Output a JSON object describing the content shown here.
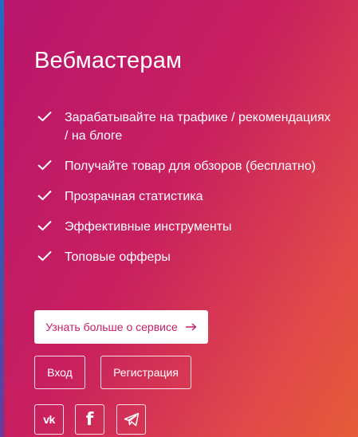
{
  "section": {
    "title": "Вебмастерам"
  },
  "features": [
    {
      "text": "Зарабатывайте на трафике / рекомендациях / на блоге"
    },
    {
      "text": "Получайте товар для обзоров (бесплатно)"
    },
    {
      "text": "Прозрачная статистика"
    },
    {
      "text": "Эффективные инструменты"
    },
    {
      "text": "Топовые офферы"
    }
  ],
  "actions": {
    "more_label": "Узнать больше о сервисе",
    "login_label": "Вход",
    "register_label": "Регистрация"
  },
  "social": {
    "vk_label": "vk",
    "fb_label": "f"
  },
  "colors": {
    "accent": "#c4206a",
    "gradient_start": "#b8166e",
    "gradient_end": "#e65c38"
  }
}
